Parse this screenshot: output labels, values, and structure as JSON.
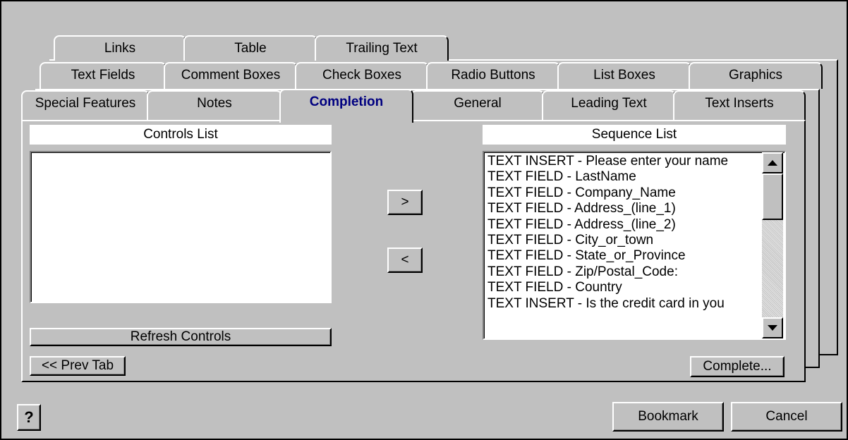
{
  "tabs": {
    "row1": [
      "Links",
      "Table",
      "Trailing Text"
    ],
    "row2": [
      "Text Fields",
      "Comment Boxes",
      "Check Boxes",
      "Radio Buttons",
      "List Boxes",
      "Graphics"
    ],
    "row3": [
      "Special Features",
      "Notes",
      "Completion",
      "General",
      "Leading Text",
      "Text Inserts"
    ],
    "active": "Completion"
  },
  "controls_list": {
    "header": "Controls List",
    "items": []
  },
  "sequence_list": {
    "header": "Sequence List",
    "items": [
      "TEXT INSERT  - Please enter your name",
      "TEXT FIELD   - LastName",
      "TEXT FIELD   - Company_Name",
      "TEXT FIELD   - Address_(line_1)",
      "TEXT FIELD   - Address_(line_2)",
      "TEXT FIELD   - City_or_town",
      "TEXT FIELD   - State_or_Province",
      "TEXT FIELD   - Zip/Postal_Code:",
      "TEXT FIELD   - Country",
      "TEXT INSERT  - Is the credit card in you"
    ]
  },
  "buttons": {
    "move_right": ">",
    "move_left": "<",
    "refresh": "Refresh Controls",
    "prev_tab": "<< Prev Tab",
    "complete": "Complete...",
    "help": "?",
    "bookmark": "Bookmark",
    "cancel": "Cancel"
  },
  "icons": {
    "help": "question-mark-icon",
    "scroll_up": "scroll-up-arrow-icon",
    "scroll_down": "scroll-down-arrow-icon"
  }
}
